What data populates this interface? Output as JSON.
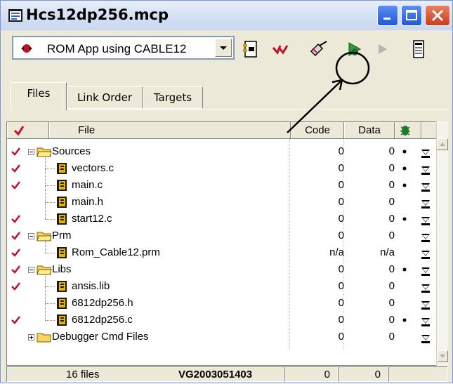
{
  "window": {
    "title": "Hcs12dp256.mcp",
    "controls": [
      "minimize",
      "maximize",
      "close"
    ]
  },
  "toolbar": {
    "target_select": "ROM App using CABLE12",
    "tools": [
      "target-settings-icon",
      "synchronize-check-icon",
      "make-icon",
      "debug-icon",
      "run-icon",
      "project-info-icon"
    ]
  },
  "tabs": [
    {
      "label": "Files",
      "active": true
    },
    {
      "label": "Link Order",
      "active": false
    },
    {
      "label": "Targets",
      "active": false
    }
  ],
  "columns": {
    "check": "",
    "file": "File",
    "code": "Code",
    "data": "Data",
    "debug": ""
  },
  "rows": [
    {
      "name": "Sources",
      "kind": "folder",
      "level": 0,
      "expanded": true,
      "check": true,
      "code": "0",
      "data": "0",
      "debug": true
    },
    {
      "name": "vectors.c",
      "kind": "file",
      "level": 1,
      "check": true,
      "code": "0",
      "data": "0",
      "debug": true
    },
    {
      "name": "main.c",
      "kind": "file",
      "level": 1,
      "check": true,
      "code": "0",
      "data": "0",
      "debug": true
    },
    {
      "name": "main.h",
      "kind": "file",
      "level": 1,
      "check": false,
      "code": "0",
      "data": "0",
      "debug": false
    },
    {
      "name": "start12.c",
      "kind": "file",
      "level": 1,
      "check": true,
      "code": "0",
      "data": "0",
      "debug": true
    },
    {
      "name": "Prm",
      "kind": "folder",
      "level": 0,
      "expanded": true,
      "check": true,
      "code": "0",
      "data": "0",
      "debug": false
    },
    {
      "name": "Rom_Cable12.prm",
      "kind": "file",
      "level": 1,
      "check": true,
      "code": "n/a",
      "data": "n/a",
      "debug": false
    },
    {
      "name": "Libs",
      "kind": "folder",
      "level": 0,
      "expanded": true,
      "check": true,
      "code": "0",
      "data": "0",
      "debug": true
    },
    {
      "name": "ansis.lib",
      "kind": "file",
      "level": 1,
      "check": true,
      "code": "0",
      "data": "0",
      "debug": false
    },
    {
      "name": "6812dp256.h",
      "kind": "file",
      "level": 1,
      "check": false,
      "code": "0",
      "data": "0",
      "debug": false
    },
    {
      "name": "6812dp256.c",
      "kind": "file",
      "level": 1,
      "check": true,
      "code": "0",
      "data": "0",
      "debug": true
    },
    {
      "name": "Debugger Cmd Files",
      "kind": "folder",
      "level": 0,
      "expanded": false,
      "check": false,
      "code": "0",
      "data": "0",
      "debug": false
    }
  ],
  "status": {
    "files": "16 files",
    "build": "VG2003051403",
    "code_total": "0",
    "data_total": "0"
  },
  "colors": {
    "check": "#c0102a",
    "window_bg": "#ece9d8",
    "title_button": "#2f66db",
    "close_button": "#d4532f",
    "folder": "#f5d55c"
  }
}
